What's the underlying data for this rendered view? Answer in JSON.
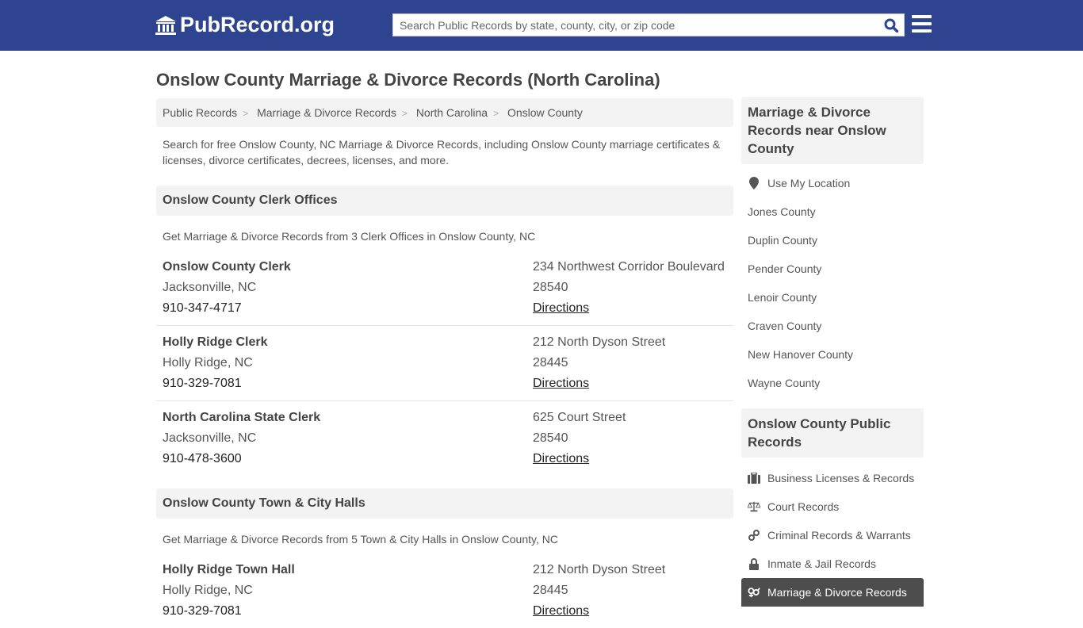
{
  "header": {
    "logo": "PubRecord.org",
    "search_placeholder": "Search Public Records by state, county, city, or zip code",
    "colors": {
      "brand": "#2e4490"
    }
  },
  "page_title": "Onslow County Marriage & Divorce Records (North Carolina)",
  "breadcrumb": [
    "Public Records",
    "Marriage & Divorce Records",
    "North Carolina",
    "Onslow County"
  ],
  "intro": "Search for free Onslow County, NC Marriage & Divorce Records, including Onslow County marriage certificates & licenses, divorce certificates, decrees, licenses, and more.",
  "sections": [
    {
      "title": "Onslow County Clerk Offices",
      "subtitle": "Get Marriage & Divorce Records from 3 Clerk Offices in Onslow County, NC",
      "entries": [
        {
          "name": "Onslow County Clerk",
          "city": "Jacksonville, NC",
          "phone": "910-347-4717",
          "address": "234 Northwest Corridor Boulevard",
          "zip": "28540",
          "link": "Directions"
        },
        {
          "name": "Holly Ridge Clerk",
          "city": "Holly Ridge, NC",
          "phone": "910-329-7081",
          "address": "212 North Dyson Street",
          "zip": "28445",
          "link": "Directions"
        },
        {
          "name": "North Carolina State Clerk",
          "city": "Jacksonville, NC",
          "phone": "910-478-3600",
          "address": "625 Court Street",
          "zip": "28540",
          "link": "Directions"
        }
      ]
    },
    {
      "title": "Onslow County Town & City Halls",
      "subtitle": "Get Marriage & Divorce Records from 5 Town & City Halls in Onslow County, NC",
      "entries": [
        {
          "name": "Holly Ridge Town Hall",
          "city": "Holly Ridge, NC",
          "phone": "910-329-7081",
          "address": "212 North Dyson Street",
          "zip": "28445",
          "link": "Directions"
        }
      ]
    }
  ],
  "sidebar": {
    "nearby_title": "Marriage & Divorce Records near Onslow County",
    "location_label": "Use My Location",
    "nearby": [
      "Jones County",
      "Duplin County",
      "Pender County",
      "Lenoir County",
      "Craven County",
      "New Hanover County",
      "Wayne County"
    ],
    "public_title": "Onslow County Public Records",
    "public": [
      {
        "label": "Business Licenses & Records",
        "icon": "briefcase-icon"
      },
      {
        "label": "Court Records",
        "icon": "scales-icon"
      },
      {
        "label": "Criminal Records & Warrants",
        "icon": "link-icon"
      },
      {
        "label": "Inmate & Jail Records",
        "icon": "lock-icon"
      },
      {
        "label": "Marriage & Divorce Records",
        "icon": "gender-icon",
        "active": true
      }
    ]
  }
}
